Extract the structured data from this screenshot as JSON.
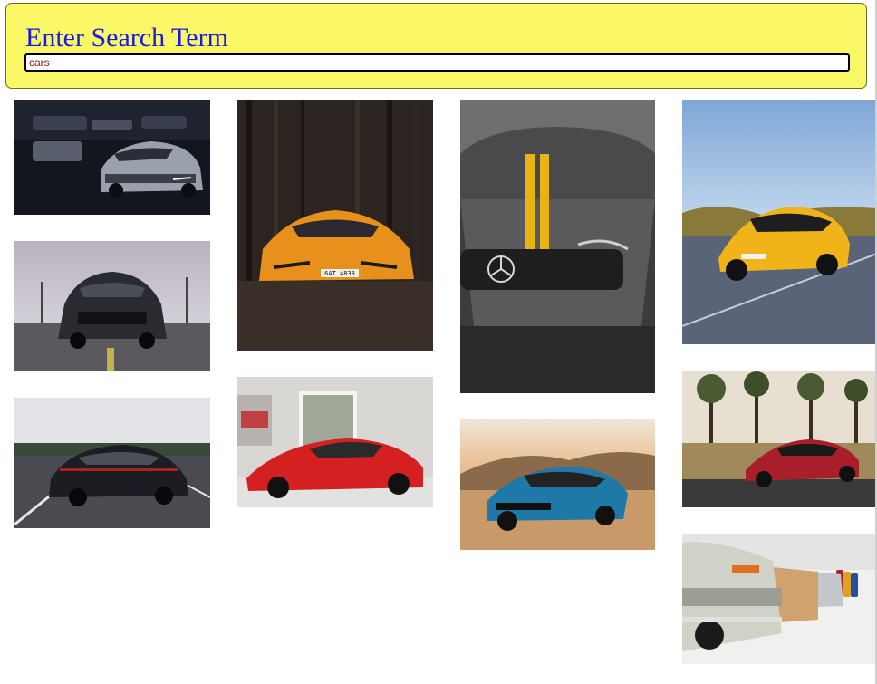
{
  "search": {
    "heading": "Enter Search Term",
    "value": "cars"
  },
  "results": [
    {
      "id": 1,
      "subject": "silver-camaro-in-garage",
      "plate": ""
    },
    {
      "id": 2,
      "subject": "dark-mustang-front",
      "plate": ""
    },
    {
      "id": 3,
      "subject": "black-porsche-panamera-road",
      "plate": ""
    },
    {
      "id": 4,
      "subject": "orange-lamborghini-forest",
      "plate": "6AT 4838"
    },
    {
      "id": 5,
      "subject": "red-laferrari-showroom",
      "plate": ""
    },
    {
      "id": 6,
      "subject": "grey-mercedes-amg-yellow-stripe",
      "plate": ""
    },
    {
      "id": 7,
      "subject": "blue-camaro-desert",
      "plate": ""
    },
    {
      "id": 8,
      "subject": "yellow-mercedes-amg-gt-road",
      "plate": ""
    },
    {
      "id": 9,
      "subject": "red-mercedes-amg-gt-field",
      "plate": ""
    },
    {
      "id": 10,
      "subject": "classic-bmw-lineup-museum",
      "plate": ""
    }
  ],
  "colors": {
    "panel_bg": "#fbf868",
    "heading": "#1a1ae0",
    "input_text": "#8a1111"
  }
}
